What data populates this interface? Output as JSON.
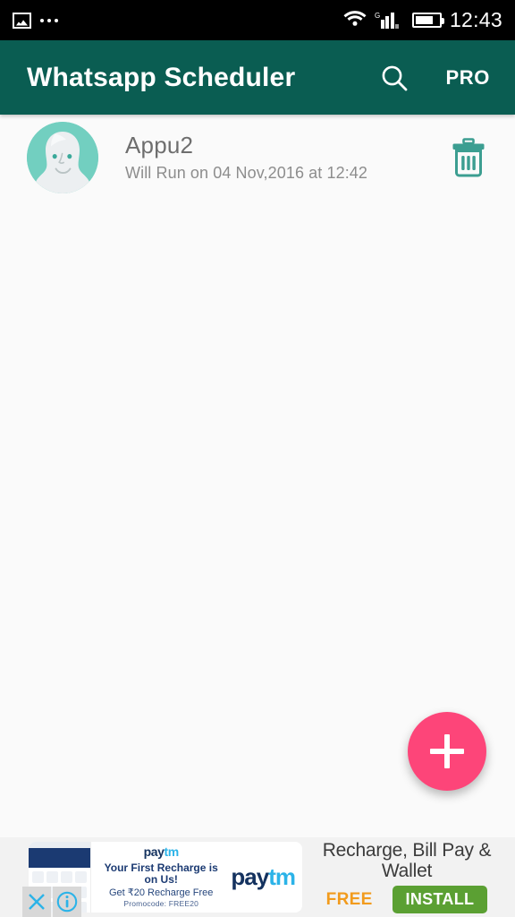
{
  "statusbar": {
    "icons": [
      "image-icon",
      "more-notifications-icon",
      "wifi-icon",
      "signal-icon",
      "battery-icon"
    ],
    "network_label": "G",
    "clock": "12:43",
    "background": "#000000"
  },
  "appbar": {
    "title": "Whatsapp Scheduler",
    "search_icon": "search-icon",
    "pro_label": "PRO",
    "background": "#0a5d52",
    "text_color": "#ffffff"
  },
  "list": {
    "items": [
      {
        "avatar": "default-person-avatar",
        "title": "Appu2",
        "subtitle": "Will Run on 04 Nov,2016 at 12:42",
        "delete_icon": "trash-icon"
      }
    ]
  },
  "fab": {
    "icon": "plus-icon",
    "label": "+",
    "color": "#fd4579"
  },
  "ad": {
    "brand": "paytm",
    "brand_part1": "pay",
    "brand_part2": "tm",
    "line1": "Your First Recharge is on Us!",
    "line2": "Get ₹20 Recharge Free",
    "line3": "Promocode: FREE20",
    "headline": "Recharge, Bill Pay & Wallet",
    "price_label": "FREE",
    "install_label": "INSTALL",
    "close_icon": "close-icon",
    "info_icon": "info-icon",
    "install_color": "#5ba033",
    "free_color": "#f29b1d"
  },
  "colors": {
    "primary": "#0a5d52",
    "accent": "#fd4579",
    "background": "#fafafa",
    "avatar": "#72cfc0"
  }
}
